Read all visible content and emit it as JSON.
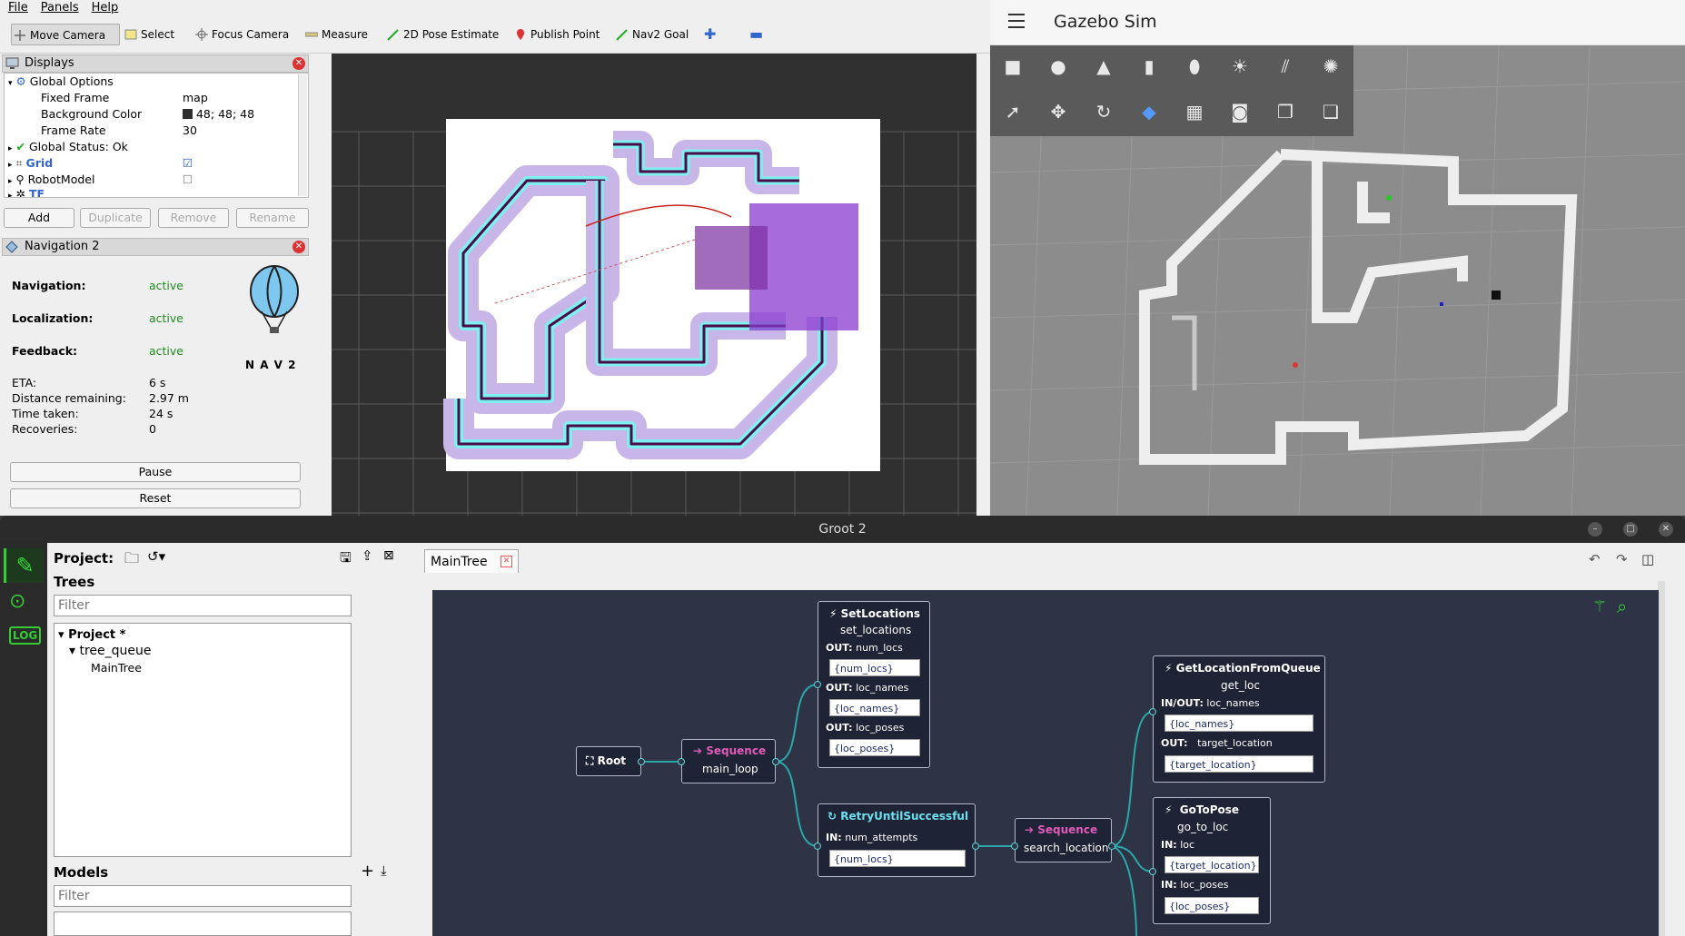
{
  "rviz": {
    "menu": [
      "File",
      "Panels",
      "Help"
    ],
    "tools": [
      "Move Camera",
      "Select",
      "Focus Camera",
      "Measure",
      "2D Pose Estimate",
      "Publish Point",
      "Nav2 Goal"
    ],
    "displays_title": "Displays",
    "tree": [
      {
        "label": "Global Options",
        "value": ""
      },
      {
        "label": "Fixed Frame",
        "value": "map"
      },
      {
        "label": "Background Color",
        "value": "48; 48; 48"
      },
      {
        "label": "Frame Rate",
        "value": "30"
      },
      {
        "label": "Global Status: Ok",
        "value": ""
      },
      {
        "label": "Grid",
        "value": ""
      },
      {
        "label": "RobotModel",
        "value": ""
      },
      {
        "label": "TF",
        "value": ""
      }
    ],
    "buttons": [
      "Add",
      "Duplicate",
      "Remove",
      "Rename"
    ],
    "nav_title": "Navigation 2",
    "nav_status": [
      {
        "label": "Navigation:",
        "value": "active"
      },
      {
        "label": "Localization:",
        "value": "active"
      },
      {
        "label": "Feedback:",
        "value": "active"
      }
    ],
    "nav_logo_text": "N A V 2",
    "progress": [
      {
        "label": "ETA:",
        "value": "6 s"
      },
      {
        "label": "Distance remaining:",
        "value": "2.97 m"
      },
      {
        "label": "Time taken:",
        "value": "24 s"
      },
      {
        "label": "Recoveries:",
        "value": "0"
      }
    ],
    "pause_label": "Pause",
    "reset_label": "Reset"
  },
  "gazebo": {
    "title": "Gazebo Sim"
  },
  "groot": {
    "window_title": "Groot 2",
    "project_label": "Project:",
    "trees_label": "Trees",
    "filter_placeholder": "Filter",
    "project_root": "Project *",
    "tree_name": "tree_queue",
    "tree_child": "MainTree",
    "models_label": "Models",
    "tab_label": "MainTree",
    "nodes": {
      "root": {
        "title": "Root"
      },
      "seq1": {
        "title": "Sequence",
        "name": "main_loop"
      },
      "setloc": {
        "title": "SetLocations",
        "name": "set_locations",
        "ports": [
          {
            "dir": "OUT:",
            "name": "num_locs",
            "value": "{num_locs}"
          },
          {
            "dir": "OUT:",
            "name": "loc_names",
            "value": "{loc_names}"
          },
          {
            "dir": "OUT:",
            "name": "loc_poses",
            "value": "{loc_poses}"
          }
        ]
      },
      "retry": {
        "title": "RetryUntilSuccessful",
        "ports": [
          {
            "dir": "IN:",
            "name": "num_attempts",
            "value": "{num_locs}"
          }
        ]
      },
      "seq2": {
        "title": "Sequence",
        "name": "search_location"
      },
      "getloc": {
        "title": "GetLocationFromQueue",
        "name": "get_loc",
        "ports": [
          {
            "dir": "IN/OUT:",
            "name": "loc_names",
            "value": "{loc_names}"
          },
          {
            "dir": "OUT:",
            "name": "target_location",
            "value": "{target_location}"
          }
        ]
      },
      "gotopose": {
        "title": "GoToPose",
        "name": "go_to_loc",
        "ports": [
          {
            "dir": "IN:",
            "name": "loc",
            "value": "{target_location}"
          },
          {
            "dir": "IN:",
            "name": "loc_poses",
            "value": "{loc_poses}"
          }
        ]
      }
    }
  }
}
